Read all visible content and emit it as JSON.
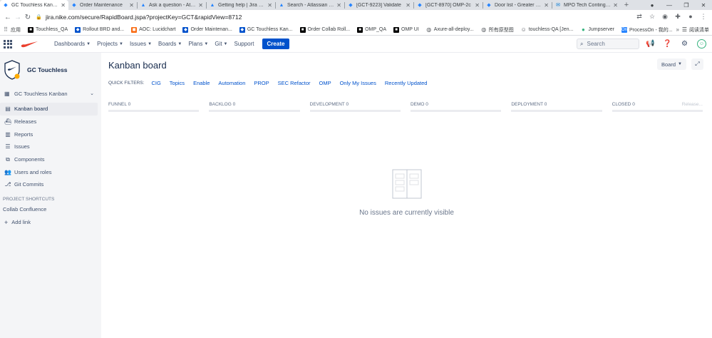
{
  "browser": {
    "tabs": [
      {
        "title": "GC Touchless Kanban",
        "icon": "jira-icon",
        "active": true
      },
      {
        "title": "Order Maintenance",
        "icon": "confluence-icon"
      },
      {
        "title": "Ask a question - Atlassian",
        "icon": "atlassian-icon"
      },
      {
        "title": "Getting help | Jira Cloud",
        "icon": "atlassian-icon"
      },
      {
        "title": "Search - Atlassian Community",
        "icon": "atlassian-icon"
      },
      {
        "title": "[GCT-9223] Validate",
        "icon": "jira-icon"
      },
      {
        "title": "[GCT-8970] OMP-2c",
        "icon": "jira-icon"
      },
      {
        "title": "Door list - Greater China",
        "icon": "confluence-icon"
      },
      {
        "title": "MPO Tech Contingency",
        "icon": "outlook-icon"
      }
    ],
    "url": "jira.nike.com/secure/RapidBoard.jspa?projectKey=GCT&rapidView=8712",
    "bookmarks": [
      {
        "label": "应用",
        "icon": "apps-grid-icon",
        "color": "#5f6368"
      },
      {
        "label": "Touchless_QA",
        "icon": "bookmark-icon",
        "color": "#000000"
      },
      {
        "label": "Rollout BRD and...",
        "icon": "confluence-icon",
        "color": "#0052cc"
      },
      {
        "label": "AOC: Lucidchart",
        "icon": "lucidchart-icon",
        "color": "#f96b13"
      },
      {
        "label": "Order Maintenan...",
        "icon": "confluence-icon",
        "color": "#0052cc"
      },
      {
        "label": "GC Touchless Kan...",
        "icon": "jira-icon",
        "color": "#0052cc"
      },
      {
        "label": "Order Collab Roll...",
        "icon": "bookmark-icon",
        "color": "#000000"
      },
      {
        "label": "OMP_QA",
        "icon": "bookmark-icon",
        "color": "#000000"
      },
      {
        "label": "OMP UI",
        "icon": "bookmark-icon",
        "color": "#000000"
      },
      {
        "label": "Axure-all-deploy...",
        "icon": "globe-icon",
        "color": "#5f6368"
      },
      {
        "label": "所有原型图",
        "icon": "globe-icon",
        "color": "#5f6368"
      },
      {
        "label": "touchless-QA [Jen...",
        "icon": "jenkins-icon",
        "color": "#5f6368"
      },
      {
        "label": "Jumpserver",
        "icon": "jumpserver-icon",
        "color": "#36b37e"
      },
      {
        "label": "ProcessOn - 我的...",
        "icon": "processon-icon",
        "color": "#2684ff"
      }
    ],
    "bookmarks_more": "»",
    "reading_list": "阅读清单"
  },
  "header": {
    "nav": [
      {
        "label": "Dashboards",
        "dropdown": true
      },
      {
        "label": "Projects",
        "dropdown": true
      },
      {
        "label": "Issues",
        "dropdown": true
      },
      {
        "label": "Boards",
        "dropdown": true
      },
      {
        "label": "Plans",
        "dropdown": true
      },
      {
        "label": "Git",
        "dropdown": true
      },
      {
        "label": "Support",
        "dropdown": false
      }
    ],
    "create_label": "Create",
    "search_placeholder": "Search",
    "accent": "#0052cc"
  },
  "sidebar": {
    "project_name": "GC Touchless",
    "board_selector": "GC Touchless Kanban",
    "items": [
      {
        "label": "Kanban board",
        "icon": "board-icon",
        "active": true
      },
      {
        "label": "Releases",
        "icon": "ship-icon"
      },
      {
        "label": "Reports",
        "icon": "chart-icon"
      },
      {
        "label": "Issues",
        "icon": "issues-icon"
      },
      {
        "label": "Components",
        "icon": "puzzle-icon"
      },
      {
        "label": "Users and roles",
        "icon": "users-icon"
      },
      {
        "label": "Git Commits",
        "icon": "git-icon"
      }
    ],
    "shortcuts_heading": "PROJECT SHORTCUTS",
    "shortcut_link": "Collab Confluence",
    "add_link": "Add link"
  },
  "main": {
    "title": "Kanban board",
    "board_button": "Board",
    "quick_filters_label": "QUICK FILTERS:",
    "quick_filters": [
      "CIG",
      "Topics",
      "Enable",
      "Automation",
      "PROP",
      "SEC Refactor",
      "OMP",
      "Only My Issues",
      "Recently Updated"
    ],
    "columns": [
      {
        "name": "FUNNEL",
        "count": "0"
      },
      {
        "name": "BACKLOG",
        "count": "0"
      },
      {
        "name": "DEVELOPMENT",
        "count": "0"
      },
      {
        "name": "DEMO",
        "count": "0"
      },
      {
        "name": "DEPLOYMENT",
        "count": "0"
      },
      {
        "name": "CLOSED",
        "count": "0",
        "extra": "Release..."
      }
    ],
    "empty_message": "No issues are currently visible"
  }
}
